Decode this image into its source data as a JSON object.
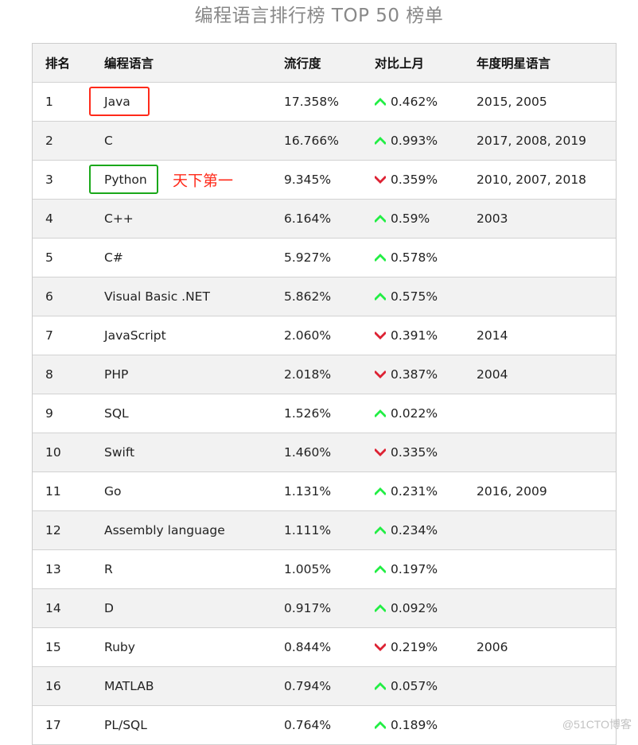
{
  "page": {
    "title": "编程语言排行榜 TOP 50 榜单",
    "watermark": "@51CTO博客"
  },
  "table": {
    "headers": {
      "rank": "排名",
      "language": "编程语言",
      "popularity": "流行度",
      "change": "对比上月",
      "star_years": "年度明星语言"
    },
    "rows": [
      {
        "rank": "1",
        "language": "Java",
        "popularity": "17.358%",
        "trend": "up",
        "change": "0.462%",
        "star_years": "2015, 2005",
        "highlight": "red"
      },
      {
        "rank": "2",
        "language": "C",
        "popularity": "16.766%",
        "trend": "up",
        "change": "0.993%",
        "star_years": "2017, 2008, 2019"
      },
      {
        "rank": "3",
        "language": "Python",
        "popularity": "9.345%",
        "trend": "down",
        "change": "0.359%",
        "star_years": "2010, 2007, 2018",
        "highlight": "green",
        "annotation": "天下第一"
      },
      {
        "rank": "4",
        "language": "C++",
        "popularity": "6.164%",
        "trend": "up",
        "change": "0.59%",
        "star_years": "2003"
      },
      {
        "rank": "5",
        "language": "C#",
        "popularity": "5.927%",
        "trend": "up",
        "change": "0.578%",
        "star_years": ""
      },
      {
        "rank": "6",
        "language": "Visual Basic .NET",
        "popularity": "5.862%",
        "trend": "up",
        "change": "0.575%",
        "star_years": ""
      },
      {
        "rank": "7",
        "language": "JavaScript",
        "popularity": "2.060%",
        "trend": "down",
        "change": "0.391%",
        "star_years": "2014"
      },
      {
        "rank": "8",
        "language": "PHP",
        "popularity": "2.018%",
        "trend": "down",
        "change": "0.387%",
        "star_years": "2004"
      },
      {
        "rank": "9",
        "language": "SQL",
        "popularity": "1.526%",
        "trend": "up",
        "change": "0.022%",
        "star_years": ""
      },
      {
        "rank": "10",
        "language": "Swift",
        "popularity": "1.460%",
        "trend": "down",
        "change": "0.335%",
        "star_years": ""
      },
      {
        "rank": "11",
        "language": "Go",
        "popularity": "1.131%",
        "trend": "up",
        "change": "0.231%",
        "star_years": "2016, 2009"
      },
      {
        "rank": "12",
        "language": "Assembly language",
        "popularity": "1.111%",
        "trend": "up",
        "change": "0.234%",
        "star_years": ""
      },
      {
        "rank": "13",
        "language": "R",
        "popularity": "1.005%",
        "trend": "up",
        "change": "0.197%",
        "star_years": ""
      },
      {
        "rank": "14",
        "language": "D",
        "popularity": "0.917%",
        "trend": "up",
        "change": "0.092%",
        "star_years": ""
      },
      {
        "rank": "15",
        "language": "Ruby",
        "popularity": "0.844%",
        "trend": "down",
        "change": "0.219%",
        "star_years": "2006"
      },
      {
        "rank": "16",
        "language": "MATLAB",
        "popularity": "0.794%",
        "trend": "up",
        "change": "0.057%",
        "star_years": ""
      },
      {
        "rank": "17",
        "language": "PL/SQL",
        "popularity": "0.764%",
        "trend": "up",
        "change": "0.189%",
        "star_years": ""
      }
    ]
  },
  "colors": {
    "trend_up": "#22ee44",
    "trend_down": "#dd2233",
    "highlight_red": "#ff2a1a",
    "highlight_green": "#1aa81a",
    "annotation": "#ff2a1a",
    "header_bg": "#f2f2f2",
    "stripe_bg": "#f2f2f2"
  },
  "icons": {
    "up": "chevron-up-icon",
    "down": "chevron-down-icon"
  }
}
